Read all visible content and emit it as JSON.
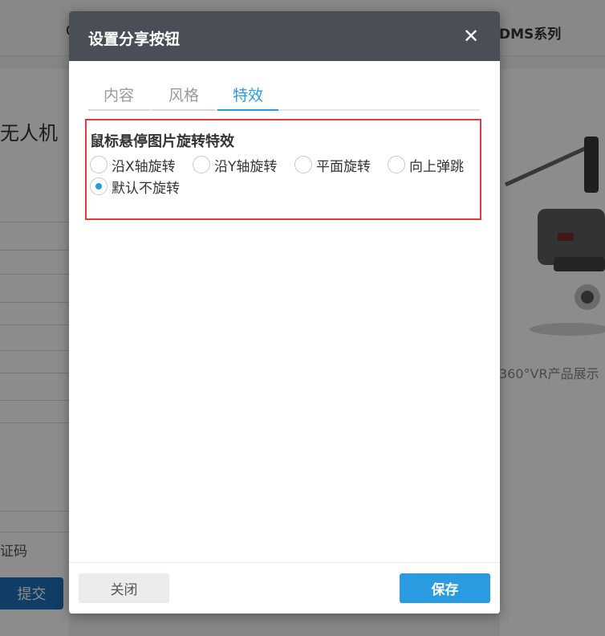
{
  "background": {
    "nav_left": "C",
    "nav_series": "DMS系列",
    "page_title": "无人机",
    "code_label": "证码",
    "submit_label": "提交",
    "caption": "360°VR产品展示"
  },
  "dialog": {
    "title": "设置分享按钮",
    "close_icon": "close-icon",
    "tabs": [
      {
        "label": "内容"
      },
      {
        "label": "风格"
      },
      {
        "label": "特效",
        "active": true
      }
    ],
    "effect": {
      "section_title": "鼠标悬停图片旋转特效",
      "options": [
        {
          "label": "沿X轴旋转",
          "checked": false
        },
        {
          "label": "沿Y轴旋转",
          "checked": false
        },
        {
          "label": "平面旋转",
          "checked": false
        },
        {
          "label": "向上弹跳",
          "checked": false
        },
        {
          "label": "默认不旋转",
          "checked": true
        }
      ]
    },
    "footer": {
      "close_label": "关闭",
      "save_label": "保存"
    }
  },
  "colors": {
    "header_bg": "#4a4f57",
    "accent": "#2a9be0",
    "highlight_border": "#e03c3c"
  }
}
